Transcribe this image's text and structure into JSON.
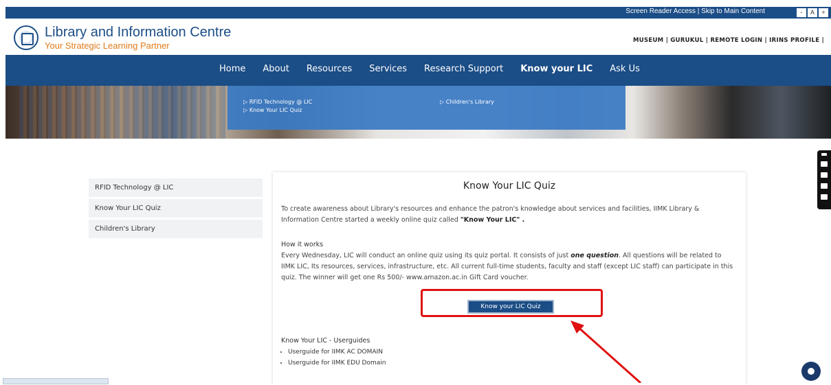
{
  "topbar": {
    "utility_text": "Screen Reader Access  | Skip to Main Content",
    "font_controls": [
      "-",
      "A",
      "+"
    ]
  },
  "header": {
    "title": "Library and Information Centre",
    "subtitle": "Your Strategic Learning Partner",
    "top_links": "MUSEUM | GURUKUL | REMOTE LOGIN | IRINS PROFILE |"
  },
  "nav": {
    "items": [
      "Home",
      "About",
      "Resources",
      "Services",
      "Research Support",
      "Know your LIC",
      "Ask Us"
    ],
    "active": "Know your LIC"
  },
  "dropdown": {
    "col1": [
      "▷ RFID Technology @ LIC",
      "▷ Know Your LIC Quiz"
    ],
    "col2": [
      "▷ Children's Library"
    ]
  },
  "sidebar": {
    "items": [
      "RFID Technology @ LIC",
      "Know Your LIC Quiz",
      "Children's Library"
    ]
  },
  "content": {
    "title": "Know Your LIC Quiz",
    "intro": "To create awareness about Library's resources and enhance the patron's knowledge about services and facilities, IIMK Library & Information Centre started a weekly online quiz called ",
    "intro_bold": "\"Know Your LIC\" .",
    "how_heading": "How it works",
    "how_text_1": "Every Wednesday, LIC will conduct an online quiz using its quiz portal. It consists of just ",
    "how_emphasis": "one question",
    "how_text_2": ". All questions will be related to IIMK LIC, Its resources, services, infrastructure, etc. All current full-time students, faculty and staff (except LIC staff) can participate in this quiz. The winner will get one Rs 500/-  www.amazon.ac.in Gift Card voucher.",
    "quiz_button": "Know your LIC Quiz",
    "guides_heading": "Know Your LIC - Userguides",
    "guides": [
      "Userguide for IIMK AC DOMAIN",
      "Userguide for IIMK EDU Domain"
    ]
  },
  "colors": {
    "brand_blue": "#1b4d86",
    "accent_orange": "#e07b1a",
    "highlight_red": "#e01010"
  }
}
